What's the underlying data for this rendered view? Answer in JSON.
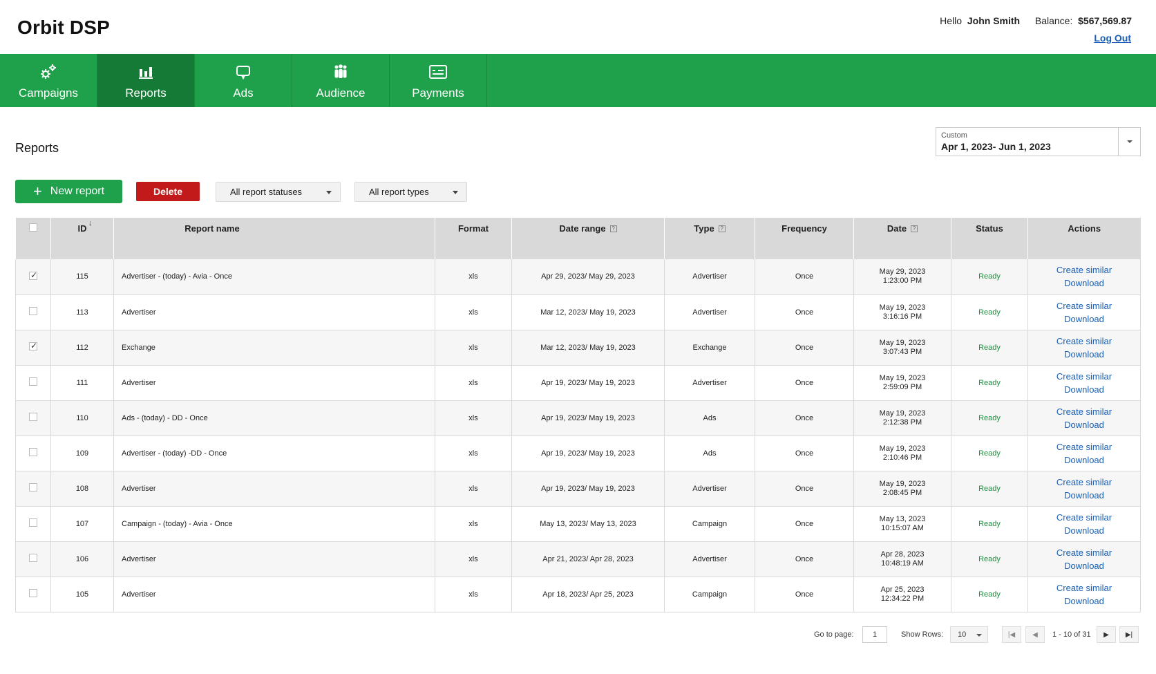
{
  "app": {
    "title": "Orbit DSP"
  },
  "user": {
    "greeting": "Hello",
    "name": "John Smith",
    "balance_label": "Balance:",
    "balance": "$567,569.87",
    "logout": "Log Out"
  },
  "nav": [
    {
      "label": "Campaigns",
      "icon": "gears-icon",
      "active": false
    },
    {
      "label": "Reports",
      "icon": "bar-chart-icon",
      "active": true
    },
    {
      "label": "Ads",
      "icon": "speech-bubble-icon",
      "active": false
    },
    {
      "label": "Audience",
      "icon": "people-icon",
      "active": false
    },
    {
      "label": "Payments",
      "icon": "credit-card-icon",
      "active": false
    }
  ],
  "page": {
    "title": "Reports"
  },
  "date_picker": {
    "label": "Custom",
    "value": "Apr 1, 2023- Jun 1, 2023"
  },
  "toolbar": {
    "new_report": "New report",
    "delete": "Delete",
    "status_filter": "All report statuses",
    "type_filter": "All report types"
  },
  "table": {
    "headers": {
      "id": "ID",
      "name": "Report name",
      "format": "Format",
      "date_range": "Date range",
      "type": "Type",
      "frequency": "Frequency",
      "date": "Date",
      "status": "Status",
      "actions": "Actions"
    },
    "help_mark": "?",
    "rows": [
      {
        "checked": true,
        "id": "115",
        "name": "Advertiser - (today) - Avia - Once",
        "format": "xls",
        "date_range": "Apr 29, 2023/ May 29, 2023",
        "type": "Advertiser",
        "frequency": "Once",
        "date": "May 29, 2023",
        "time": "1:23:00 PM",
        "status": "Ready",
        "action1": "Create similar",
        "action2": "Download"
      },
      {
        "checked": false,
        "id": "113",
        "name": "Advertiser",
        "format": "xls",
        "date_range": "Mar 12, 2023/ May 19, 2023",
        "type": "Advertiser",
        "frequency": "Once",
        "date": "May 19, 2023",
        "time": "3:16:16 PM",
        "status": "Ready",
        "action1": "Create similar",
        "action2": "Download"
      },
      {
        "checked": true,
        "id": "112",
        "name": "Exchange",
        "format": "xls",
        "date_range": "Mar 12, 2023/ May 19, 2023",
        "type": "Exchange",
        "frequency": "Once",
        "date": "May 19, 2023",
        "time": "3:07:43 PM",
        "status": "Ready",
        "action1": "Create similar",
        "action2": "Download"
      },
      {
        "checked": false,
        "id": "111",
        "name": "Advertiser",
        "format": "xls",
        "date_range": "Apr 19, 2023/ May 19, 2023",
        "type": "Advertiser",
        "frequency": "Once",
        "date": "May 19, 2023",
        "time": "2:59:09 PM",
        "status": "Ready",
        "action1": "Create similar",
        "action2": "Download"
      },
      {
        "checked": false,
        "id": "110",
        "name": "Ads - (today) - DD - Once",
        "format": "xls",
        "date_range": "Apr 19, 2023/ May 19, 2023",
        "type": "Ads",
        "frequency": "Once",
        "date": "May 19, 2023",
        "time": "2:12:38 PM",
        "status": "Ready",
        "action1": "Create similar",
        "action2": "Download"
      },
      {
        "checked": false,
        "id": "109",
        "name": "Advertiser - (today) -DD - Once",
        "format": "xls",
        "date_range": "Apr 19, 2023/ May 19, 2023",
        "type": "Ads",
        "frequency": "Once",
        "date": "May 19, 2023",
        "time": "2:10:46 PM",
        "status": "Ready",
        "action1": "Create similar",
        "action2": "Download"
      },
      {
        "checked": false,
        "id": "108",
        "name": "Advertiser",
        "format": "xls",
        "date_range": "Apr 19, 2023/ May 19, 2023",
        "type": "Advertiser",
        "frequency": "Once",
        "date": "May 19, 2023",
        "time": "2:08:45 PM",
        "status": "Ready",
        "action1": "Create similar",
        "action2": "Download"
      },
      {
        "checked": false,
        "id": "107",
        "name": "Campaign - (today) - Avia - Once",
        "format": "xls",
        "date_range": "May 13, 2023/ May 13, 2023",
        "type": "Campaign",
        "frequency": "Once",
        "date": "May 13, 2023",
        "time": "10:15:07 AM",
        "status": "Ready",
        "action1": "Create similar",
        "action2": "Download"
      },
      {
        "checked": false,
        "id": "106",
        "name": "Advertiser",
        "format": "xls",
        "date_range": "Apr 21, 2023/ Apr 28, 2023",
        "type": "Advertiser",
        "frequency": "Once",
        "date": "Apr 28, 2023",
        "time": "10:48:19 AM",
        "status": "Ready",
        "action1": "Create similar",
        "action2": "Download"
      },
      {
        "checked": false,
        "id": "105",
        "name": "Advertiser",
        "format": "xls",
        "date_range": "Apr 18, 2023/ Apr 25, 2023",
        "type": "Campaign",
        "frequency": "Once",
        "date": "Apr 25, 2023",
        "time": "12:34:22 PM",
        "status": "Ready",
        "action1": "Create similar",
        "action2": "Download"
      }
    ]
  },
  "pagination": {
    "goto_label": "Go to page:",
    "page": "1",
    "rows_label": "Show Rows:",
    "rows": "10",
    "range": "1 - 10 of 31"
  },
  "colors": {
    "brand_green": "#1ea14a",
    "active_tab": "#147a36",
    "delete_red": "#c21a1a",
    "link_blue": "#1a5fb4",
    "status_green": "#1e8f3f"
  }
}
